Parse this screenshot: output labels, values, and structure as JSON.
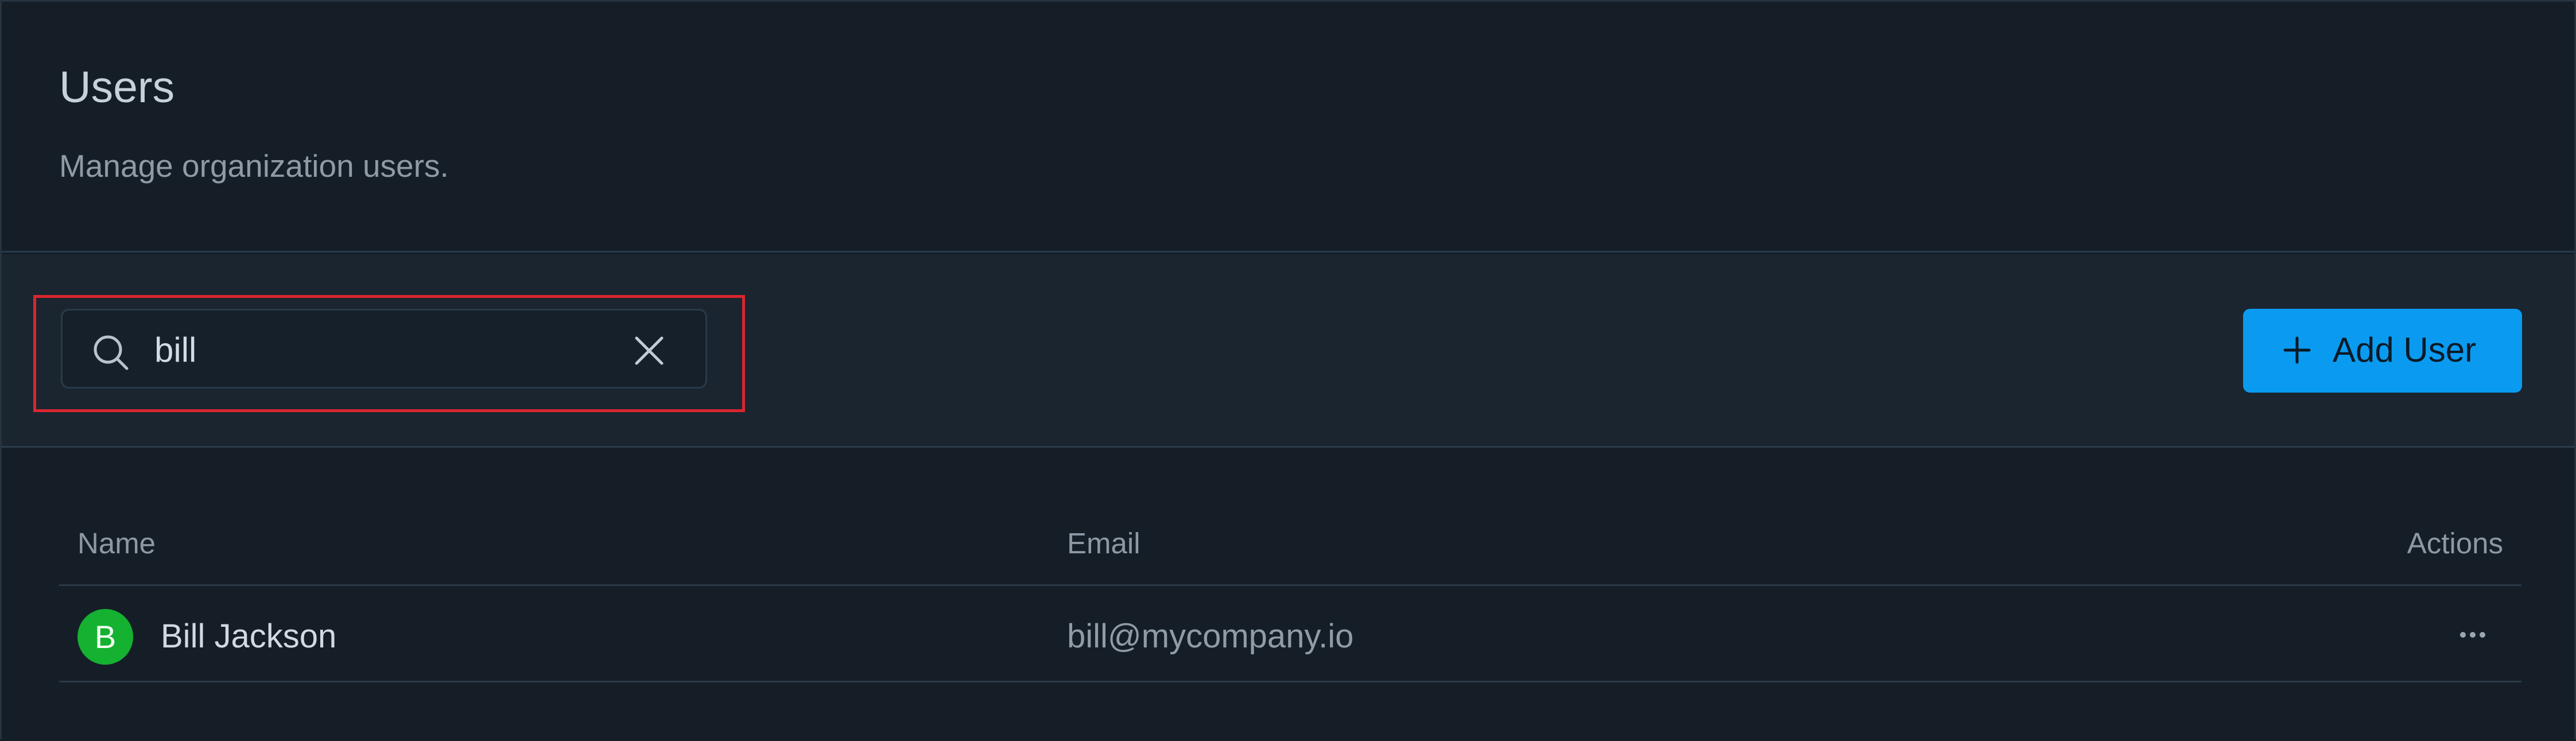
{
  "header": {
    "title": "Users",
    "subtitle": "Manage organization users."
  },
  "toolbar": {
    "search": {
      "value": "bill",
      "icon": "search-icon",
      "clear_icon": "close-icon"
    },
    "add_button_label": "Add User",
    "add_button_icon": "plus-icon"
  },
  "table": {
    "columns": [
      "Name",
      "Email",
      "Actions"
    ],
    "rows": [
      {
        "avatar_initial": "B",
        "name": "Bill Jackson",
        "email": "bill@mycompany.io",
        "actions_icon": "more-horizontal-icon"
      }
    ]
  },
  "colors": {
    "background": "#151e27",
    "toolbar_background": "#1a2530",
    "accent": "#0a9bf0",
    "avatar": "#15b131",
    "highlight": "#d9262e"
  }
}
